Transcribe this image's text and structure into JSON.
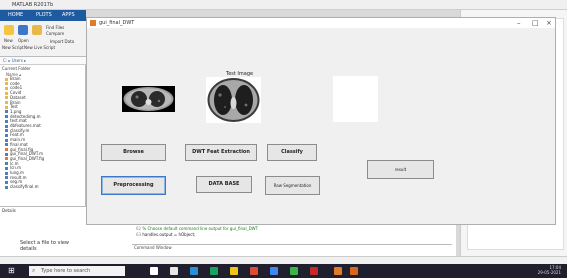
{
  "matlab": {
    "title": "MATLAB R2017b",
    "tabs": [
      "HOME",
      "PLOTS",
      "APPS"
    ],
    "ribbon_labels": [
      "New",
      "Open",
      "Find Files",
      "Compare",
      "New Script",
      "New Live Script",
      "Import Data"
    ],
    "address": "C: ▸ Users ▸",
    "folder_header": "Current Folder",
    "folder_col": "Name ▴",
    "files": [
      {
        "name": "Brain",
        "kind": "folder"
      },
      {
        "name": "code",
        "kind": "folder"
      },
      {
        "name": "code1",
        "kind": "folder"
      },
      {
        "name": "Covid",
        "kind": "folder"
      },
      {
        "name": "Dataset",
        "kind": "folder"
      },
      {
        "name": "Brain",
        "kind": "folder"
      },
      {
        "name": "Test",
        "kind": "folder"
      },
      {
        "name": "1.png",
        "kind": "file"
      },
      {
        "name": "detectedimg.m",
        "kind": "file"
      },
      {
        "name": "test.mat",
        "kind": "file"
      },
      {
        "name": "dbfeatures.mat",
        "kind": "file"
      },
      {
        "name": "classify.m",
        "kind": "file"
      },
      {
        "name": "Feat.m",
        "kind": "file"
      },
      {
        "name": "main.m",
        "kind": "file"
      },
      {
        "name": "final.mat",
        "kind": "file"
      },
      {
        "name": "gui_final.fig",
        "kind": "fig"
      },
      {
        "name": "gui_final_DWT.m",
        "kind": "file"
      },
      {
        "name": "gui_final_DWT.fig",
        "kind": "fig"
      },
      {
        "name": "lc.m",
        "kind": "file"
      },
      {
        "name": "lcn.m",
        "kind": "file"
      },
      {
        "name": "lung.m",
        "kind": "file"
      },
      {
        "name": "result.m",
        "kind": "file"
      },
      {
        "name": "seg.m",
        "kind": "file"
      },
      {
        "name": "classifyfinal.m",
        "kind": "file"
      }
    ],
    "details_header": "Details",
    "details_msg": "Select a file to view details",
    "code_lines": [
      {
        "num": "60",
        "text": "%   varargin   command line arguments to gui_final_DWT (see VARARGIN)",
        "color": "#1a7f1a"
      },
      {
        "num": "61",
        "text": "",
        "color": "#1a7f1a"
      },
      {
        "num": "62",
        "text": "% Choose default command line output for gui_final_DWT",
        "color": "#1a7f1a"
      },
      {
        "num": "63",
        "text": "handles.output = hObject;",
        "color": "#222"
      }
    ],
    "cmd_header": "Command Window"
  },
  "gui": {
    "window_title": "gui_final_DWT",
    "controls": {
      "minimize": "–",
      "maximize": "□",
      "close": "×"
    },
    "test_image_label": "Test Image",
    "buttons": {
      "browse": "Browse",
      "dwt": "DWT Feat Extraction",
      "classify": "Classify",
      "preprocessing": "Preprocessing",
      "database": "DATA BASE",
      "segmentation": "Raw Segmentation",
      "result": "result"
    }
  },
  "taskbar": {
    "search_placeholder": "Type here to search",
    "time": "17:04",
    "date": "29-05-2021"
  }
}
